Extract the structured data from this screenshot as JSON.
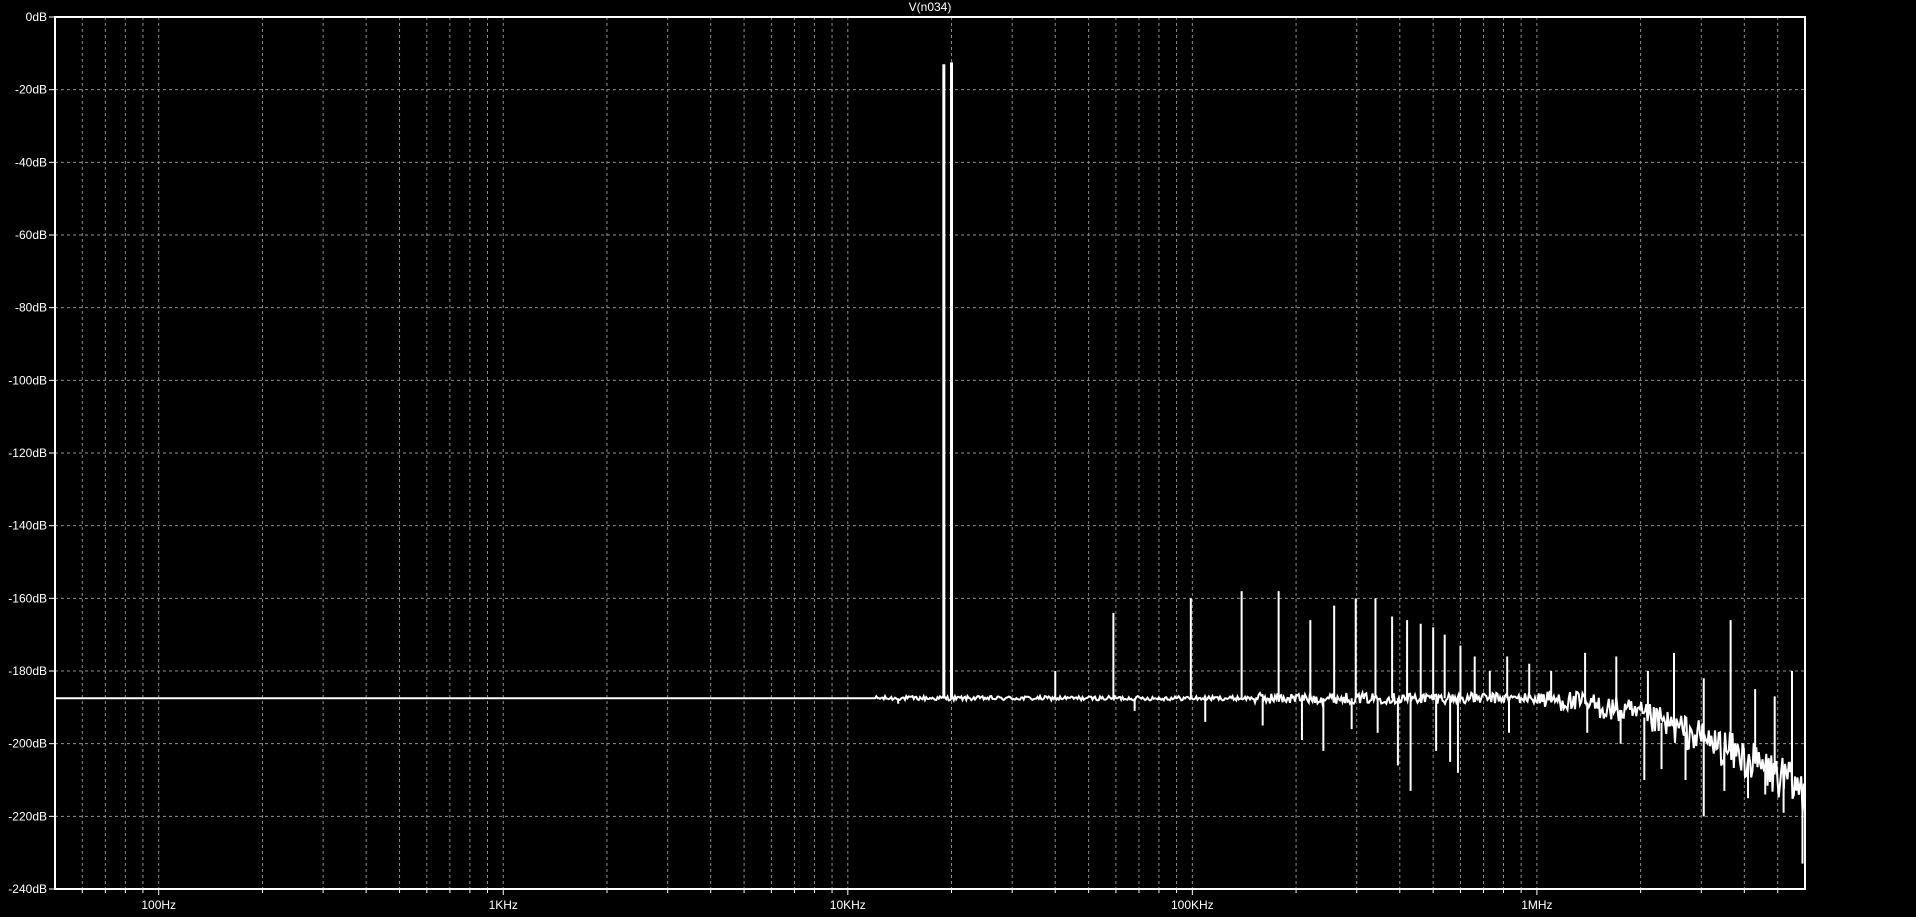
{
  "chart_data": {
    "type": "line",
    "title": "V(n034)",
    "xlabel": "",
    "ylabel": "",
    "x_scale": "log",
    "x_unit": "Hz",
    "xlim": [
      50,
      6000000
    ],
    "ylim": [
      -240,
      0
    ],
    "grid": true,
    "y_ticks": [
      0,
      -20,
      -40,
      -60,
      -80,
      -100,
      -120,
      -140,
      -160,
      -180,
      -200,
      -220,
      -240
    ],
    "y_tick_labels": [
      "0dB",
      "-20dB",
      "-40dB",
      "-60dB",
      "-80dB",
      "-100dB",
      "-120dB",
      "-140dB",
      "-160dB",
      "-180dB",
      "-200dB",
      "-220dB",
      "-240dB"
    ],
    "x_ticks": [
      100,
      1000,
      10000,
      100000,
      1000000
    ],
    "x_tick_labels": [
      "100Hz",
      "1KHz",
      "10KHz",
      "100KHz",
      "1MHz"
    ],
    "colors": {
      "background": "#000000",
      "trace": "#ffffff",
      "grid": "#8c8c8c",
      "frame": "#ffffff"
    },
    "series": [
      {
        "noise_floor_db": -187.5,
        "peaks": [
          {
            "x": 19000,
            "y": -13
          },
          {
            "x": 20000,
            "y": -12.5
          },
          {
            "x": 40000,
            "y": -180
          },
          {
            "x": 59000,
            "y": -164
          },
          {
            "x": 80000,
            "y": -188
          },
          {
            "x": 99000,
            "y": -160
          },
          {
            "x": 139000,
            "y": -158
          },
          {
            "x": 178000,
            "y": -158
          },
          {
            "x": 220000,
            "y": -166
          },
          {
            "x": 258000,
            "y": -162
          },
          {
            "x": 298000,
            "y": -160
          },
          {
            "x": 340000,
            "y": -160
          },
          {
            "x": 380000,
            "y": -165
          },
          {
            "x": 420000,
            "y": -166
          },
          {
            "x": 460000,
            "y": -167
          },
          {
            "x": 500000,
            "y": -168
          },
          {
            "x": 540000,
            "y": -170
          },
          {
            "x": 600000,
            "y": -173
          },
          {
            "x": 660000,
            "y": -176
          },
          {
            "x": 730000,
            "y": -180
          },
          {
            "x": 820000,
            "y": -176
          },
          {
            "x": 950000,
            "y": -178
          },
          {
            "x": 1100000,
            "y": -180
          },
          {
            "x": 1380000,
            "y": -175
          },
          {
            "x": 1700000,
            "y": -176
          },
          {
            "x": 2100000,
            "y": -180
          },
          {
            "x": 2500000,
            "y": -175
          },
          {
            "x": 3050000,
            "y": -182
          },
          {
            "x": 3650000,
            "y": -166
          },
          {
            "x": 4300000,
            "y": -185
          },
          {
            "x": 4900000,
            "y": -187
          },
          {
            "x": 5500000,
            "y": -180
          }
        ],
        "dips": [
          {
            "x": 14000,
            "y": -189
          },
          {
            "x": 68000,
            "y": -191
          },
          {
            "x": 109000,
            "y": -194
          },
          {
            "x": 160000,
            "y": -195
          },
          {
            "x": 208000,
            "y": -199
          },
          {
            "x": 240000,
            "y": -202
          },
          {
            "x": 290000,
            "y": -196
          },
          {
            "x": 345000,
            "y": -197
          },
          {
            "x": 395000,
            "y": -206
          },
          {
            "x": 430000,
            "y": -213
          },
          {
            "x": 510000,
            "y": -202
          },
          {
            "x": 560000,
            "y": -205
          },
          {
            "x": 590000,
            "y": -208
          },
          {
            "x": 830000,
            "y": -197
          },
          {
            "x": 1400000,
            "y": -197
          },
          {
            "x": 1750000,
            "y": -200
          },
          {
            "x": 2050000,
            "y": -210
          },
          {
            "x": 2300000,
            "y": -207
          },
          {
            "x": 2700000,
            "y": -210
          },
          {
            "x": 3050000,
            "y": -220
          },
          {
            "x": 3500000,
            "y": -213
          },
          {
            "x": 4100000,
            "y": -215
          },
          {
            "x": 4600000,
            "y": -214
          },
          {
            "x": 5200000,
            "y": -219
          },
          {
            "x": 5900000,
            "y": -233
          }
        ]
      }
    ]
  }
}
